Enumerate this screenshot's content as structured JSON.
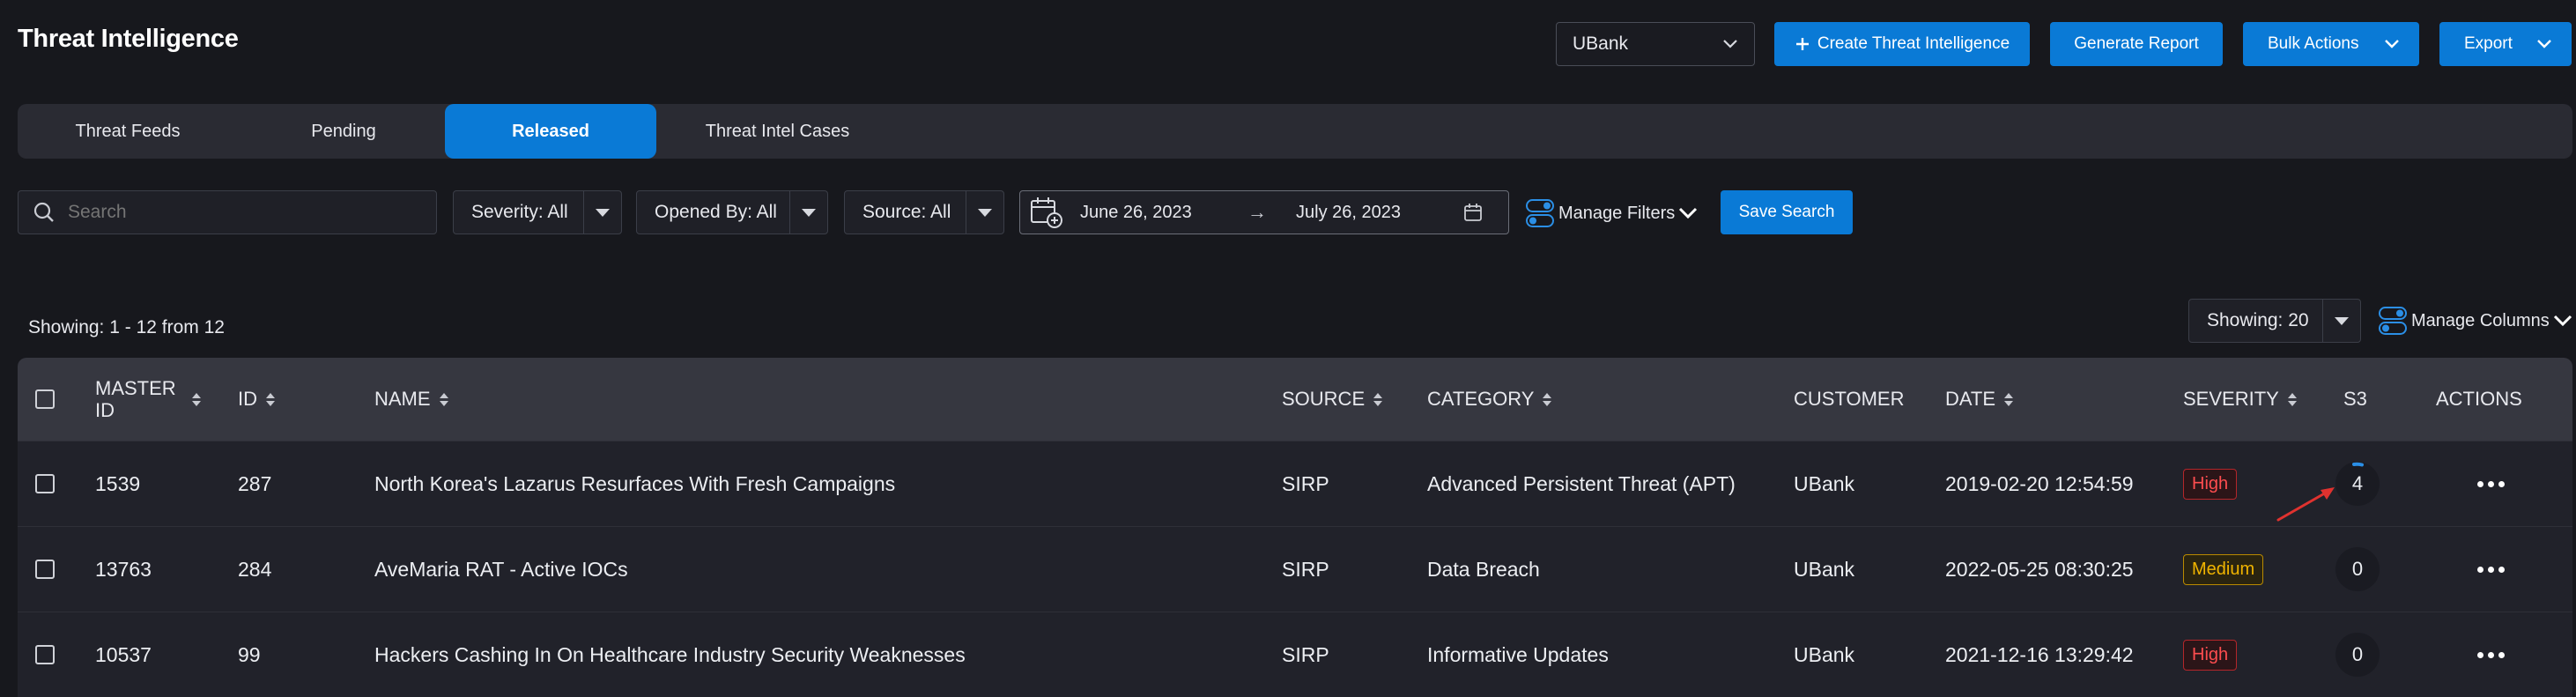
{
  "page": {
    "title": "Threat Intelligence"
  },
  "header": {
    "org_select": "UBank",
    "create_button": "Create Threat Intelligence",
    "report_button": "Generate Report",
    "bulk_button": "Bulk Actions",
    "export_button": "Export"
  },
  "tabs": [
    "Threat Feeds",
    "Pending",
    "Released",
    "Threat Intel Cases"
  ],
  "active_tab": "Released",
  "filters": {
    "search_placeholder": "Search",
    "severity": "Severity: All",
    "opened_by": "Opened By: All",
    "source": "Source: All",
    "date_from": "June 26, 2023",
    "date_arrow": "→",
    "date_to": "July 26, 2023",
    "manage_filters": "Manage Filters",
    "save_search": "Save Search"
  },
  "summary": {
    "showing_text": "Showing: 1 - 12 from 12",
    "page_size": "Showing: 20",
    "manage_columns": "Manage Columns"
  },
  "table": {
    "columns": {
      "master_id": "MASTER ID",
      "id": "ID",
      "name": "NAME",
      "source": "SOURCE",
      "category": "CATEGORY",
      "customer": "CUSTOMER",
      "date": "DATE",
      "severity": "SEVERITY",
      "s3": "S3",
      "actions": "ACTIONS"
    },
    "rows": [
      {
        "master_id": "1539",
        "id": "287",
        "name": "North Korea's Lazarus Resurfaces With Fresh Campaigns",
        "source": "SIRP",
        "category": "Advanced Persistent Threat (APT)",
        "customer": "UBank",
        "date": "2019-02-20 12:54:59",
        "severity": "High",
        "s3": "4"
      },
      {
        "master_id": "13763",
        "id": "284",
        "name": "AveMaria RAT - Active IOCs",
        "source": "SIRP",
        "category": "Data Breach",
        "customer": "UBank",
        "date": "2022-05-25 08:30:25",
        "severity": "Medium",
        "s3": "0"
      },
      {
        "master_id": "10537",
        "id": "99",
        "name": "Hackers Cashing In On Healthcare Industry Security Weaknesses",
        "source": "SIRP",
        "category": "Informative Updates",
        "customer": "UBank",
        "date": "2021-12-16 13:29:42",
        "severity": "High",
        "s3": "0"
      }
    ]
  },
  "colors": {
    "accent": "#0a7ad6",
    "high": "#ff4d4f",
    "medium": "#f0b400",
    "annotation_arrow": "#e0322f"
  }
}
